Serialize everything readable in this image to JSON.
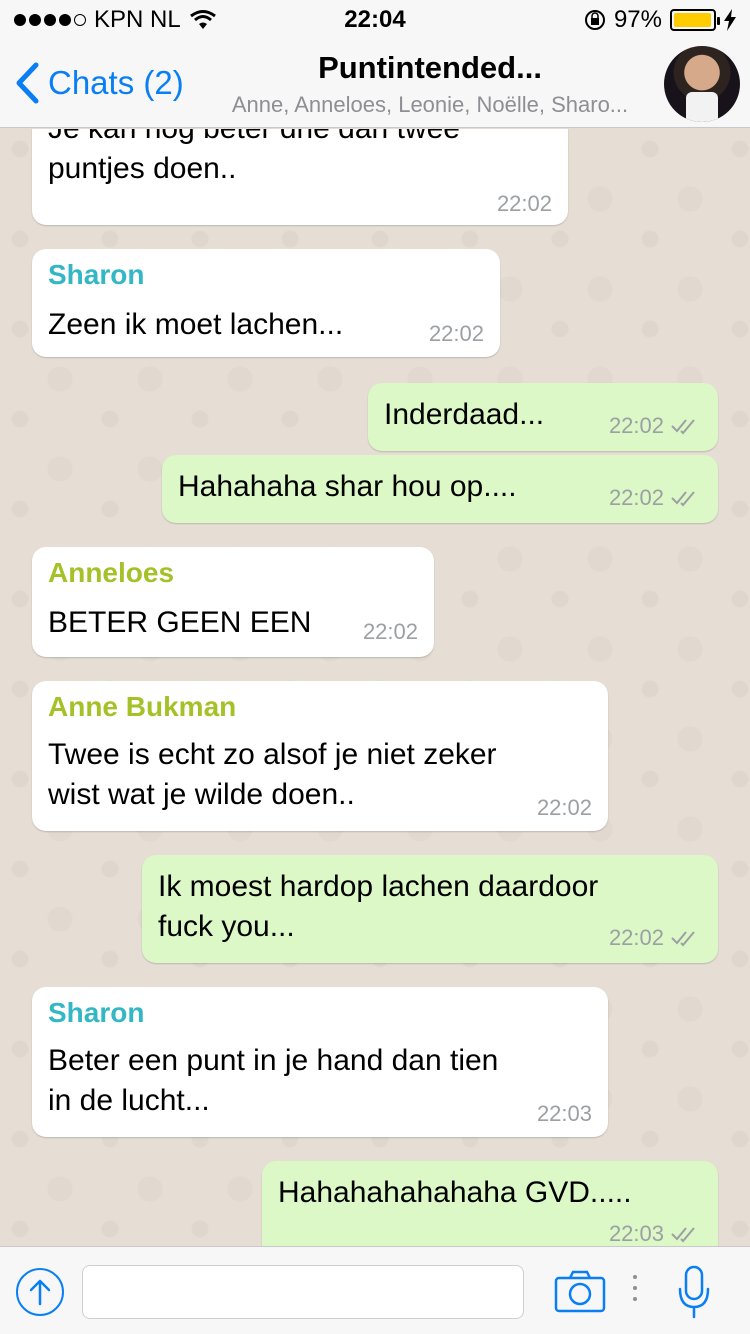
{
  "status": {
    "carrier": "KPN NL",
    "time": "22:04",
    "battery": "97%",
    "battery_level": 0.97
  },
  "nav": {
    "back_label": "Chats (2)",
    "title": "Puntintended...",
    "members": "Anne, Anneloes, Leonie, Noëlle, Sharo..."
  },
  "messages": [
    {
      "dir": "in",
      "text": "Je kan nog beter drie dan twee\npuntjes doen..",
      "time": "22:02"
    },
    {
      "dir": "in",
      "sender": "Sharon",
      "text": "Zeen ik moet lachen...",
      "time": "22:02"
    },
    {
      "dir": "out",
      "text": "Inderdaad...",
      "time": "22:02"
    },
    {
      "dir": "out",
      "text": "Hahahaha shar hou op....",
      "time": "22:02"
    },
    {
      "dir": "in",
      "sender": "Anneloes",
      "text": "BETER GEEN EEN",
      "time": "22:02"
    },
    {
      "dir": "in",
      "sender": "Anne Bukman",
      "text": "Twee is echt zo alsof je niet zeker\nwist wat je wilde doen..",
      "time": "22:02"
    },
    {
      "dir": "out",
      "text": "Ik moest hardop lachen daardoor\nfuck you...",
      "time": "22:02"
    },
    {
      "dir": "in",
      "sender": "Sharon",
      "text": "Beter een punt in je hand dan tien\nin de lucht...",
      "time": "22:03"
    },
    {
      "dir": "out",
      "text": "Hahahahahahaha GVD.....",
      "time": "22:03"
    }
  ],
  "colors": {
    "accent": "#0a7ff5",
    "sharon": "#34b7c5",
    "anneloes": "#a4c227",
    "anne": "#a4c227",
    "outgoing": "#dcf8c6",
    "ticks": "#9ca0a3"
  }
}
